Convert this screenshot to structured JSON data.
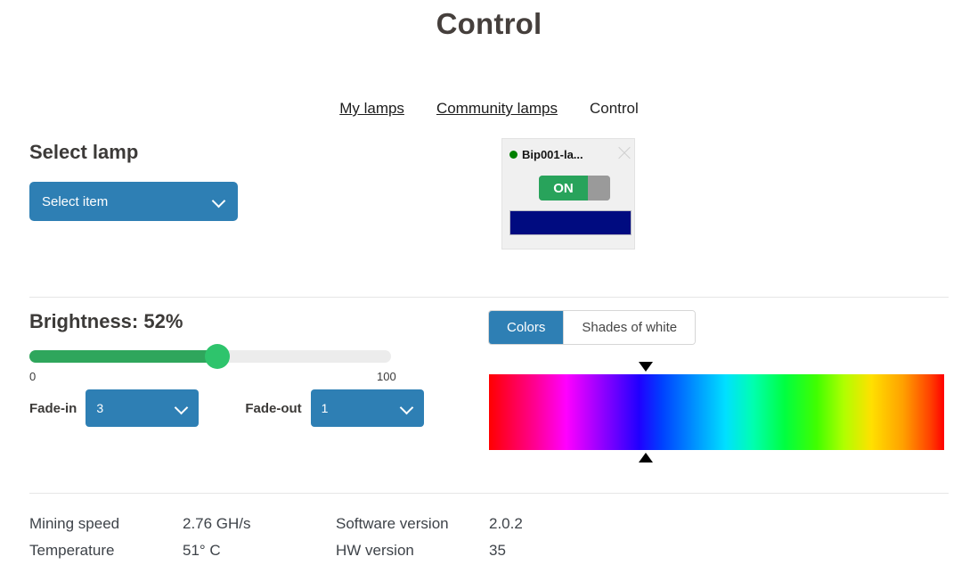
{
  "header": {
    "title": "Control"
  },
  "nav": {
    "links": [
      {
        "label": "My lamps",
        "current": false
      },
      {
        "label": "Community lamps",
        "current": false
      },
      {
        "label": "Control",
        "current": true
      }
    ]
  },
  "select_lamp": {
    "heading": "Select lamp",
    "dropdown_value": "Select item"
  },
  "lamp_card": {
    "name": "Bip001-la...",
    "status_color": "#008000",
    "toggle_state": "ON",
    "toggle_on_color": "#28a35b",
    "color_swatch": "#000b80",
    "close_icon": "close-icon"
  },
  "brightness": {
    "heading": "Brightness: 52%",
    "value": 52,
    "min_label": "0",
    "max_label": "100",
    "fill_color": "#2fa65c",
    "thumb_color": "#2ec46c"
  },
  "fade": {
    "in_label": "Fade-in",
    "in_value": "3",
    "out_label": "Fade-out",
    "out_value": "1"
  },
  "color_tabs": {
    "colors_label": "Colors",
    "white_label": "Shades of white",
    "active": "Colors",
    "accent": "#2e7fb4"
  },
  "spectrum": {
    "marker_position_percent": 34.5
  },
  "stats": {
    "rows": [
      {
        "label": "Mining speed",
        "value": "2.76 GH/s",
        "label2": "Software version",
        "value2": "2.0.2"
      },
      {
        "label": "Temperature",
        "value": "51° C",
        "label2": "HW version",
        "value2": "35"
      }
    ]
  }
}
